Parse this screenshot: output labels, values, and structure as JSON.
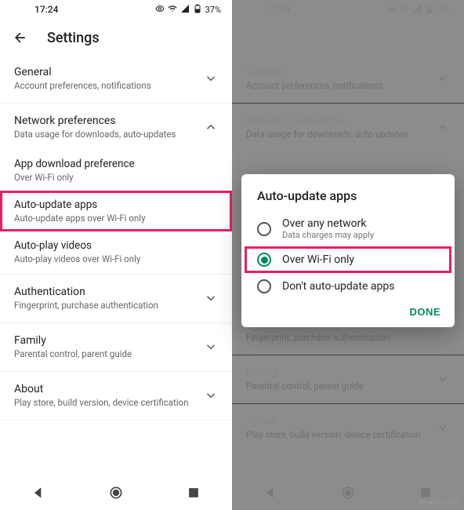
{
  "status": {
    "time": "17:24",
    "battery": "37%"
  },
  "appbar": {
    "title": "Settings"
  },
  "sections": {
    "general": {
      "label": "General",
      "sub": "Account preferences, notifications"
    },
    "network": {
      "label": "Network preferences",
      "sub": "Data usage for downloads, auto-updates"
    },
    "download": {
      "label": "App download preference",
      "sub": "Over Wi-Fi only"
    },
    "autoupdate": {
      "label": "Auto-update apps",
      "sub": "Auto-update apps over Wi-Fi only"
    },
    "autoplay": {
      "label": "Auto-play videos",
      "sub": "Auto-play videos over Wi-Fi only"
    },
    "auth": {
      "label": "Authentication",
      "sub": "Fingerprint, purchase authentication"
    },
    "family": {
      "label": "Family",
      "sub": "Parental control, parent guide"
    },
    "about": {
      "label": "About",
      "sub": "Play store, build version, device certification"
    }
  },
  "dialog": {
    "title": "Auto-update apps",
    "opt1": {
      "label": "Over any network",
      "sub": "Data charges may apply"
    },
    "opt2": {
      "label": "Over Wi-Fi only"
    },
    "opt3": {
      "label": "Don't auto-update apps"
    },
    "done": "DONE"
  },
  "watermark": "wsxdn.com"
}
